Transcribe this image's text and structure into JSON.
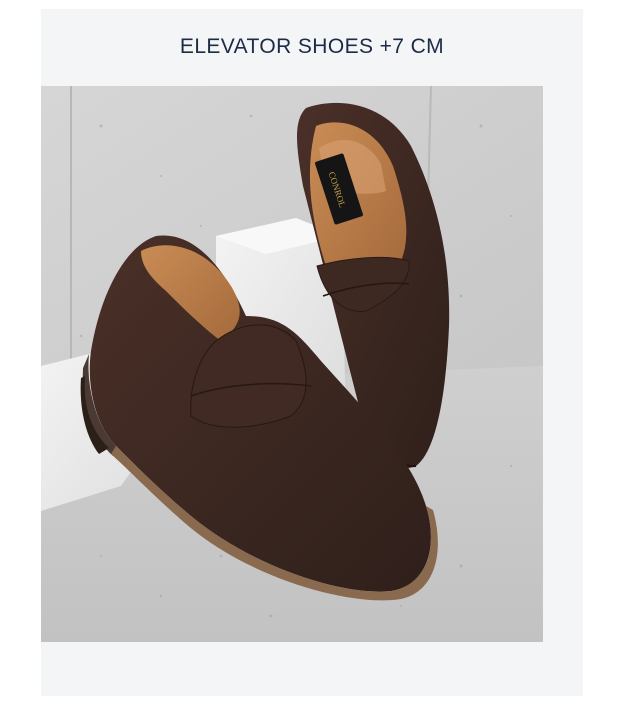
{
  "product": {
    "title": "ELEVATOR SHOES +7 CM",
    "image_alt": "Brown suede penny loafers on concrete blocks",
    "insole_brand": "CONROL"
  },
  "colors": {
    "card_background": "#f3f5f7",
    "title_text": "#1d2b45",
    "suede": "#3b2620",
    "lining": "#b77b4a"
  }
}
